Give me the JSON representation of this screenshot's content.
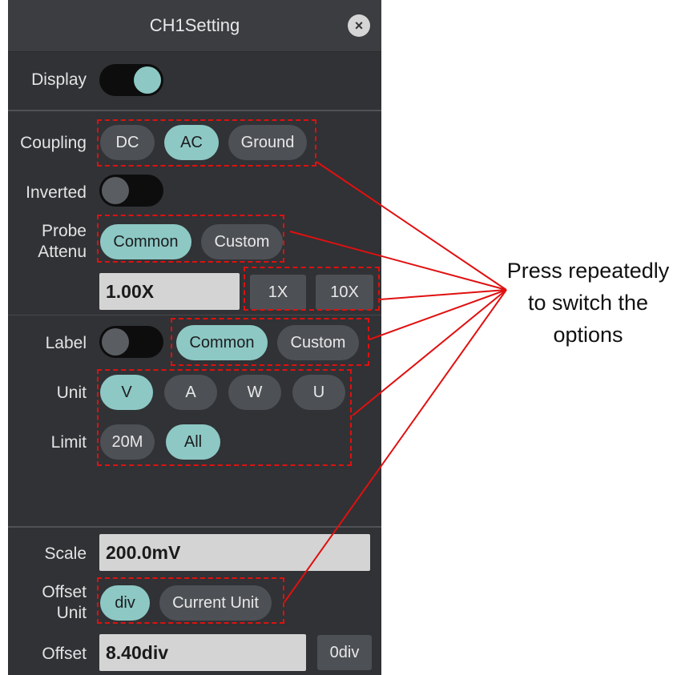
{
  "dialog": {
    "title": "CH1Setting",
    "close_glyph": "×",
    "close_icon": "close-icon"
  },
  "display": {
    "label": "Display",
    "on": true
  },
  "coupling": {
    "label": "Coupling",
    "options": [
      "DC",
      "AC",
      "Ground"
    ],
    "selected": "AC"
  },
  "inverted": {
    "label": "Inverted",
    "on": false
  },
  "probe_attenu": {
    "label_line1": "Probe",
    "label_line2": "Attenu",
    "options": [
      "Common",
      "Custom"
    ],
    "selected": "Common",
    "value": "1.00X",
    "presets": [
      "1X",
      "10X"
    ]
  },
  "label_setting": {
    "label": "Label",
    "on": false,
    "options": [
      "Common",
      "Custom"
    ],
    "selected": "Common"
  },
  "unit": {
    "label": "Unit",
    "options": [
      "V",
      "A",
      "W",
      "U"
    ],
    "selected": "V"
  },
  "limit": {
    "label": "Limit",
    "options": [
      "20M",
      "All"
    ],
    "selected": "All"
  },
  "scale": {
    "label": "Scale",
    "value": "200.0mV"
  },
  "offset_unit": {
    "label_line1": "Offset",
    "label_line2": "Unit",
    "options": [
      "div",
      "Current Unit"
    ],
    "selected": "div"
  },
  "offset": {
    "label": "Offset",
    "value": "8.40div",
    "reset_label": "0div"
  },
  "annotation": {
    "line1": "Press repeatedly",
    "line2": "to switch the",
    "line3": "options",
    "color": "#e01010"
  },
  "colors": {
    "panel_bg": "#303235",
    "selected_accent": "#8dc8c4",
    "button_bg": "#4d5055",
    "field_bg": "#d4d4d4"
  }
}
